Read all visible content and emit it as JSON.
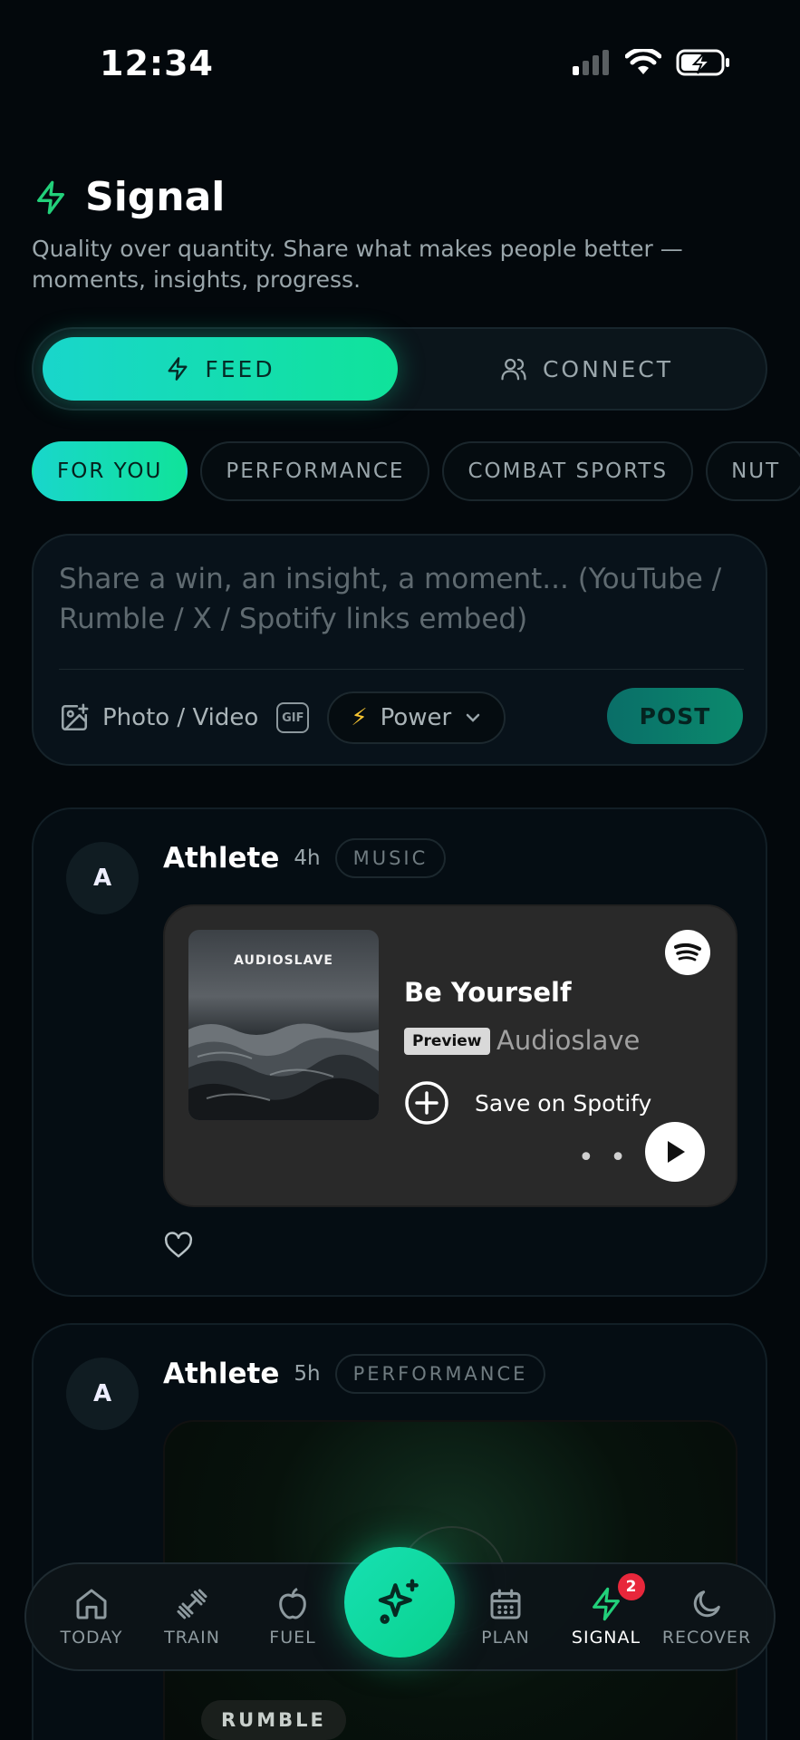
{
  "status_bar": {
    "time": "12:34"
  },
  "header": {
    "title": "Signal",
    "subtitle": "Quality over quantity. Share what makes people better — moments, insights, progress."
  },
  "segment": {
    "feed_label": "FEED",
    "connect_label": "CONNECT",
    "selected": "FEED"
  },
  "chips": [
    "FOR YOU",
    "PERFORMANCE",
    "COMBAT SPORTS",
    "NUT"
  ],
  "composer": {
    "placeholder": "Share a win, an insight, a moment... (YouTube / Rumble / X / Spotify links embed)",
    "photo_label": "Photo / Video",
    "gif_label": "GIF",
    "power_label": "Power",
    "post_label": "POST"
  },
  "posts": [
    {
      "avatar": "A",
      "author": "Athlete",
      "time": "4h",
      "tag": "MUSIC",
      "embed": {
        "album_text": "AUDIOSLAVE",
        "title": "Be Yourself",
        "badge": "Preview",
        "artist": "Audioslave",
        "save_label": "Save on Spotify",
        "more": "• • •"
      }
    },
    {
      "avatar": "A",
      "author": "Athlete",
      "time": "5h",
      "tag": "PERFORMANCE",
      "embed": {
        "source": "RUMBLE"
      }
    }
  ],
  "nav": {
    "items": [
      {
        "label": "TODAY",
        "icon": "home-icon"
      },
      {
        "label": "TRAIN",
        "icon": "dumbbell-icon"
      },
      {
        "label": "FUEL",
        "icon": "apple-icon"
      },
      {
        "label": "PLAN",
        "icon": "calendar-icon"
      },
      {
        "label": "SIGNAL",
        "icon": "bolt-icon",
        "badge": "2"
      },
      {
        "label": "RECOVER",
        "icon": "moon-icon"
      }
    ],
    "active": "SIGNAL"
  },
  "colors": {
    "accent": "#10e39a",
    "accent_teal": "#19d6cb",
    "background": "#03080c",
    "badge": "#e8273b"
  }
}
